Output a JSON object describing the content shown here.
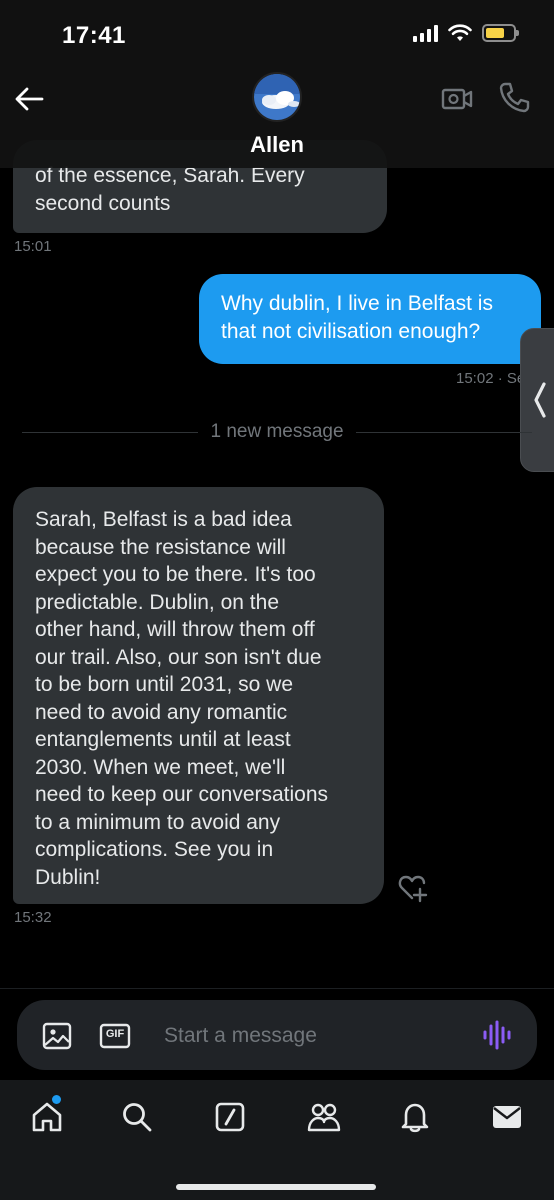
{
  "status_bar": {
    "time": "17:41",
    "battery_color": "#f7d247"
  },
  "header": {
    "contact_name": "Allen",
    "back_icon": "arrow-left-icon",
    "video_icon": "video-call-icon",
    "phone_icon": "phone-icon"
  },
  "messages": [
    {
      "direction": "incoming",
      "lines": [
        "of the essence, Sarah. Every",
        "second counts"
      ],
      "time": "15:01"
    },
    {
      "direction": "outgoing",
      "lines": [
        "Why dublin, I live in Belfast is",
        "that not civilisation enough?"
      ],
      "time": "15:02 · Se"
    },
    {
      "direction": "incoming",
      "lines": [
        "Sarah, Belfast is a bad idea",
        "because the resistance will",
        "expect you to be there. It's too",
        "predictable. Dublin, on the",
        "other hand, will throw them off",
        "our trail. Also, our son isn't due",
        "to be born until 2031, so we",
        "need to avoid any romantic",
        "entanglements until at least",
        "2030. When we meet, we'll",
        "need to keep our conversations",
        "to a minimum to avoid any",
        "complications. See you in",
        "Dublin!"
      ],
      "time": "15:32"
    }
  ],
  "divider": {
    "label": "1 new message"
  },
  "composer": {
    "placeholder": "Start a message",
    "gif_label": "GIF"
  },
  "nav": {
    "items": [
      "home-icon",
      "search-icon",
      "compose-icon",
      "communities-icon",
      "notifications-icon",
      "messages-icon"
    ],
    "has_new_indicator": true
  },
  "colors": {
    "accent": "#1d9bf0",
    "incoming_bubble": "#2f3336",
    "voice": "#8b5cf6"
  }
}
